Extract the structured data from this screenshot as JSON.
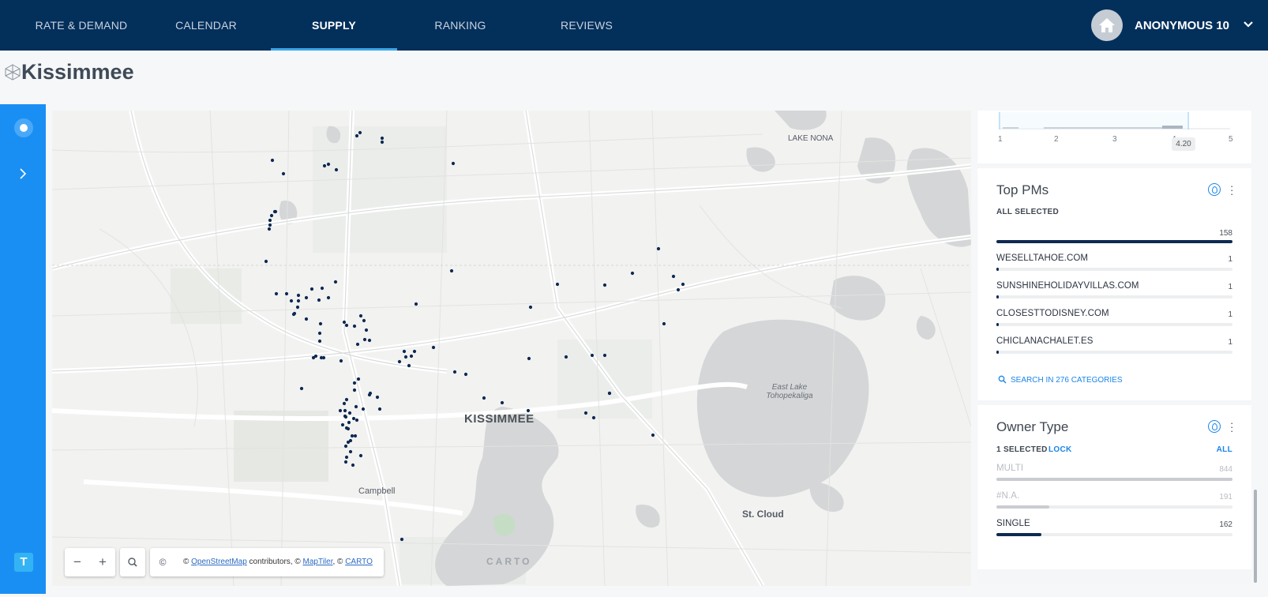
{
  "nav": {
    "tabs": [
      {
        "label": "RATE & DEMAND"
      },
      {
        "label": "CALENDAR"
      },
      {
        "label": "SUPPLY"
      },
      {
        "label": "RANKING"
      },
      {
        "label": "REVIEWS"
      }
    ],
    "active_tab": "SUPPLY",
    "user": {
      "name": "ANONYMOUS 10",
      "avatar_icon": "home-icon"
    }
  },
  "page": {
    "title": "Kissimmee"
  },
  "rail": {
    "toggle_label": "T"
  },
  "map": {
    "labels": {
      "city": "KISSIMMEE",
      "lake_nona": "LAKE NONA",
      "lake": "East Lake Tohopekaliga",
      "campbell": "Campbell",
      "st_cloud": "St. Cloud",
      "carto": "CARTO"
    },
    "controls": {
      "zoom_out": "−",
      "zoom_in": "+",
      "search_icon": "search-icon",
      "attrib_icon": "©"
    },
    "attribution": {
      "prefix": "©",
      "osm": "OpenStreetMap",
      "contributors": "contributors, ©",
      "maptiler": "MapTiler",
      "sep": ", ©",
      "carto": "CARTO"
    },
    "marker_color": "#0e2a52"
  },
  "rating_histogram": {
    "ticks": [
      "1",
      "2",
      "3",
      "4",
      "5"
    ],
    "selected_value": "4.20"
  },
  "top_pms": {
    "title": "Top PMs",
    "status": "ALL SELECTED",
    "total": "158",
    "rows": [
      {
        "label": "WESELLTAHOE.COM",
        "value": "1"
      },
      {
        "label": "SUNSHINEHOLIDAYVILLAS.COM",
        "value": "1"
      },
      {
        "label": "CLOSESTTODISNEY.COM",
        "value": "1"
      },
      {
        "label": "CHICLANACHALET.ES",
        "value": "1"
      }
    ],
    "search_link": "SEARCH IN 276 CATEGORIES"
  },
  "owner_type": {
    "title": "Owner Type",
    "status": "1 SELECTED",
    "lock": "LOCK",
    "all": "ALL",
    "rows": [
      {
        "label": "MULTI",
        "value": "844",
        "selected": false
      },
      {
        "label": "#N.A.",
        "value": "191",
        "selected": false
      },
      {
        "label": "SINGLE",
        "value": "162",
        "selected": true
      }
    ]
  }
}
